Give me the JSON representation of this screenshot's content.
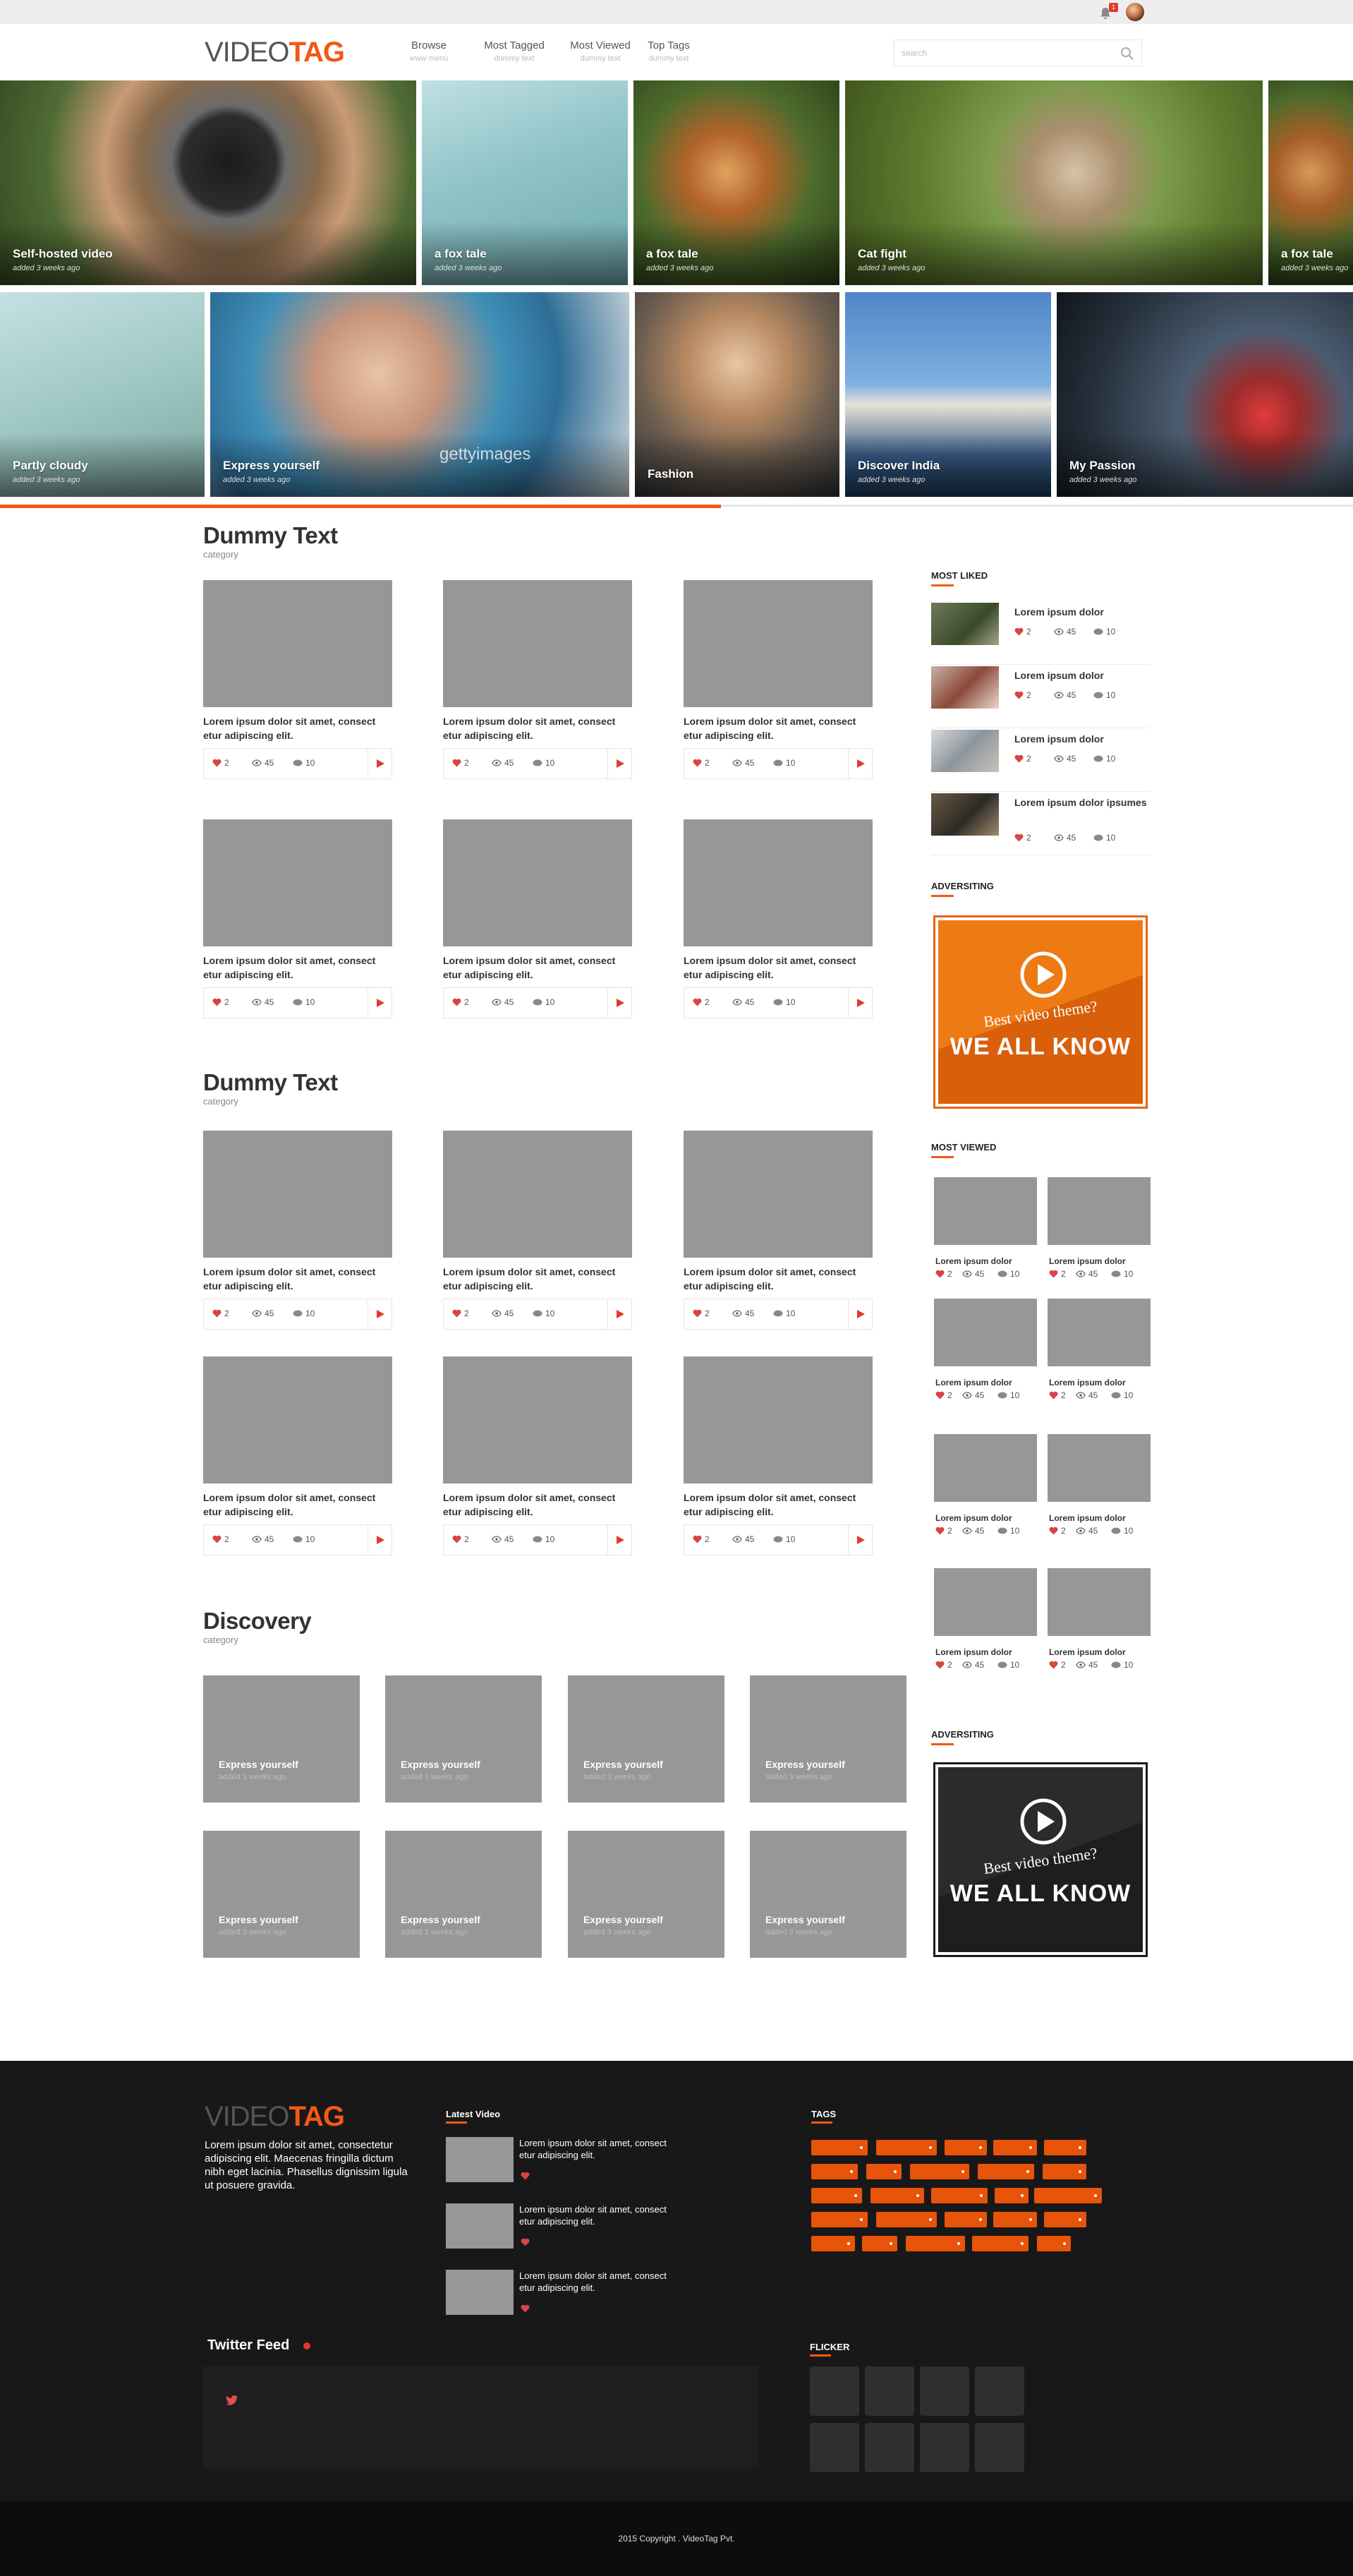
{
  "topbar": {
    "notification_count": "1"
  },
  "header": {
    "logo_video": "VIDEO",
    "logo_tag": "TAG",
    "nav": [
      {
        "label": "Browse",
        "sub": "www menu"
      },
      {
        "label": "Most Tagged",
        "sub": "dummy text"
      },
      {
        "label": "Most Viewed",
        "sub": "dummy text"
      },
      {
        "label": "Top Tags",
        "sub": "dummy text"
      }
    ],
    "search_placeholder": "search"
  },
  "hero": {
    "row1": [
      {
        "title": "Self-hosted video",
        "sub": "added 3 weeks ago"
      },
      {
        "title": "a fox tale",
        "sub": "added 3 weeks ago"
      },
      {
        "title": "a fox tale",
        "sub": "added 3 weeks ago"
      },
      {
        "title": "Cat fight",
        "sub": "added 3 weeks ago"
      },
      {
        "title": "a fox tale",
        "sub": "added 3 weeks ago"
      }
    ],
    "row2": [
      {
        "title": "Partly cloudy",
        "sub": "added 3 weeks ago"
      },
      {
        "title": "Express yourself",
        "sub": "added 3 weeks ago"
      },
      {
        "title": "Fashion",
        "sub": ""
      },
      {
        "title": "Discover India",
        "sub": "added 3 weeks ago"
      },
      {
        "title": "My Passion",
        "sub": "added 3 weeks ago"
      }
    ],
    "watermark": "gettyimages",
    "slider_progress_fraction": 0.533
  },
  "sections": [
    {
      "title": "Dummy Text",
      "sub": "category"
    },
    {
      "title": "Dummy Text",
      "sub": "category"
    },
    {
      "title": "Discovery",
      "sub": "category"
    }
  ],
  "card": {
    "text": "Lorem ipsum dolor sit amet, consect etur adipiscing elit.",
    "likes": "2",
    "views": "45",
    "comments": "10"
  },
  "discovery": {
    "title": "Express yourself",
    "sub": "added 3 weeks ago"
  },
  "sidebar": {
    "most_liked_title": "MOST LIKED",
    "most_liked": [
      {
        "title": "Lorem ipsum dolor"
      },
      {
        "title": "Lorem ipsum dolor"
      },
      {
        "title": "Lorem ipsum dolor"
      },
      {
        "title": "Lorem ipsum dolor ipsumes"
      }
    ],
    "ad_title": "ADVERSITING",
    "ad_line1": "Best video theme?",
    "ad_line2": "WE ALL KNOW",
    "most_viewed_title": "MOST VIEWED",
    "most_viewed_item": "Lorem ipsum dolor",
    "ad2_title": "ADVERSITING"
  },
  "footer": {
    "logo_video": "VIDEO",
    "logo_tag": "TAG",
    "about": "Lorem ipsum dolor sit amet, consectetur adipiscing elit. Maecenas fringilla dictum nibh eget lacinia. Phasellus dignissim ligula ut posuere gravida.",
    "latest_title": "Latest Video",
    "latest_text": "Lorem ipsum dolor sit amet, consect etur adipiscing elit.",
    "tags_title": "TAGS",
    "twitter_title": "Twitter Feed",
    "flicker_title": "FLICKER",
    "copyright": "2015 Copyright . VideoTag Pvt."
  },
  "colors": {
    "accent": "#f05a14",
    "placeholder": "#979797",
    "footer_bg": "#181818"
  }
}
